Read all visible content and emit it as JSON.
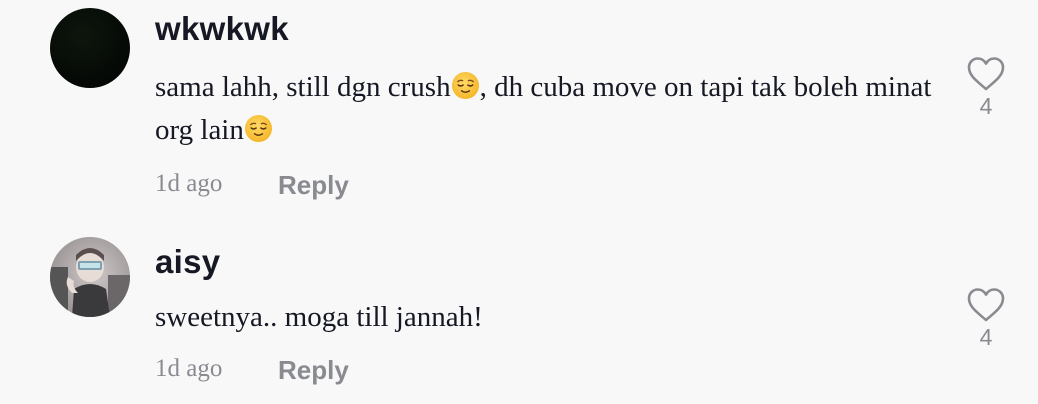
{
  "comments": [
    {
      "username": "wkwkwk",
      "text_1": "sama lahh, still dgn crush",
      "text_2": ", dh cuba move on tapi tak boleh minat org lain",
      "emoji": "relieved-face",
      "time": "1d ago",
      "reply_label": "Reply",
      "like_count": "4",
      "avatar_color": "#050a05"
    },
    {
      "username": "aisy",
      "text": "sweetnya.. moga till jannah!",
      "time": "1d ago",
      "reply_label": "Reply",
      "like_count": "4"
    }
  ]
}
